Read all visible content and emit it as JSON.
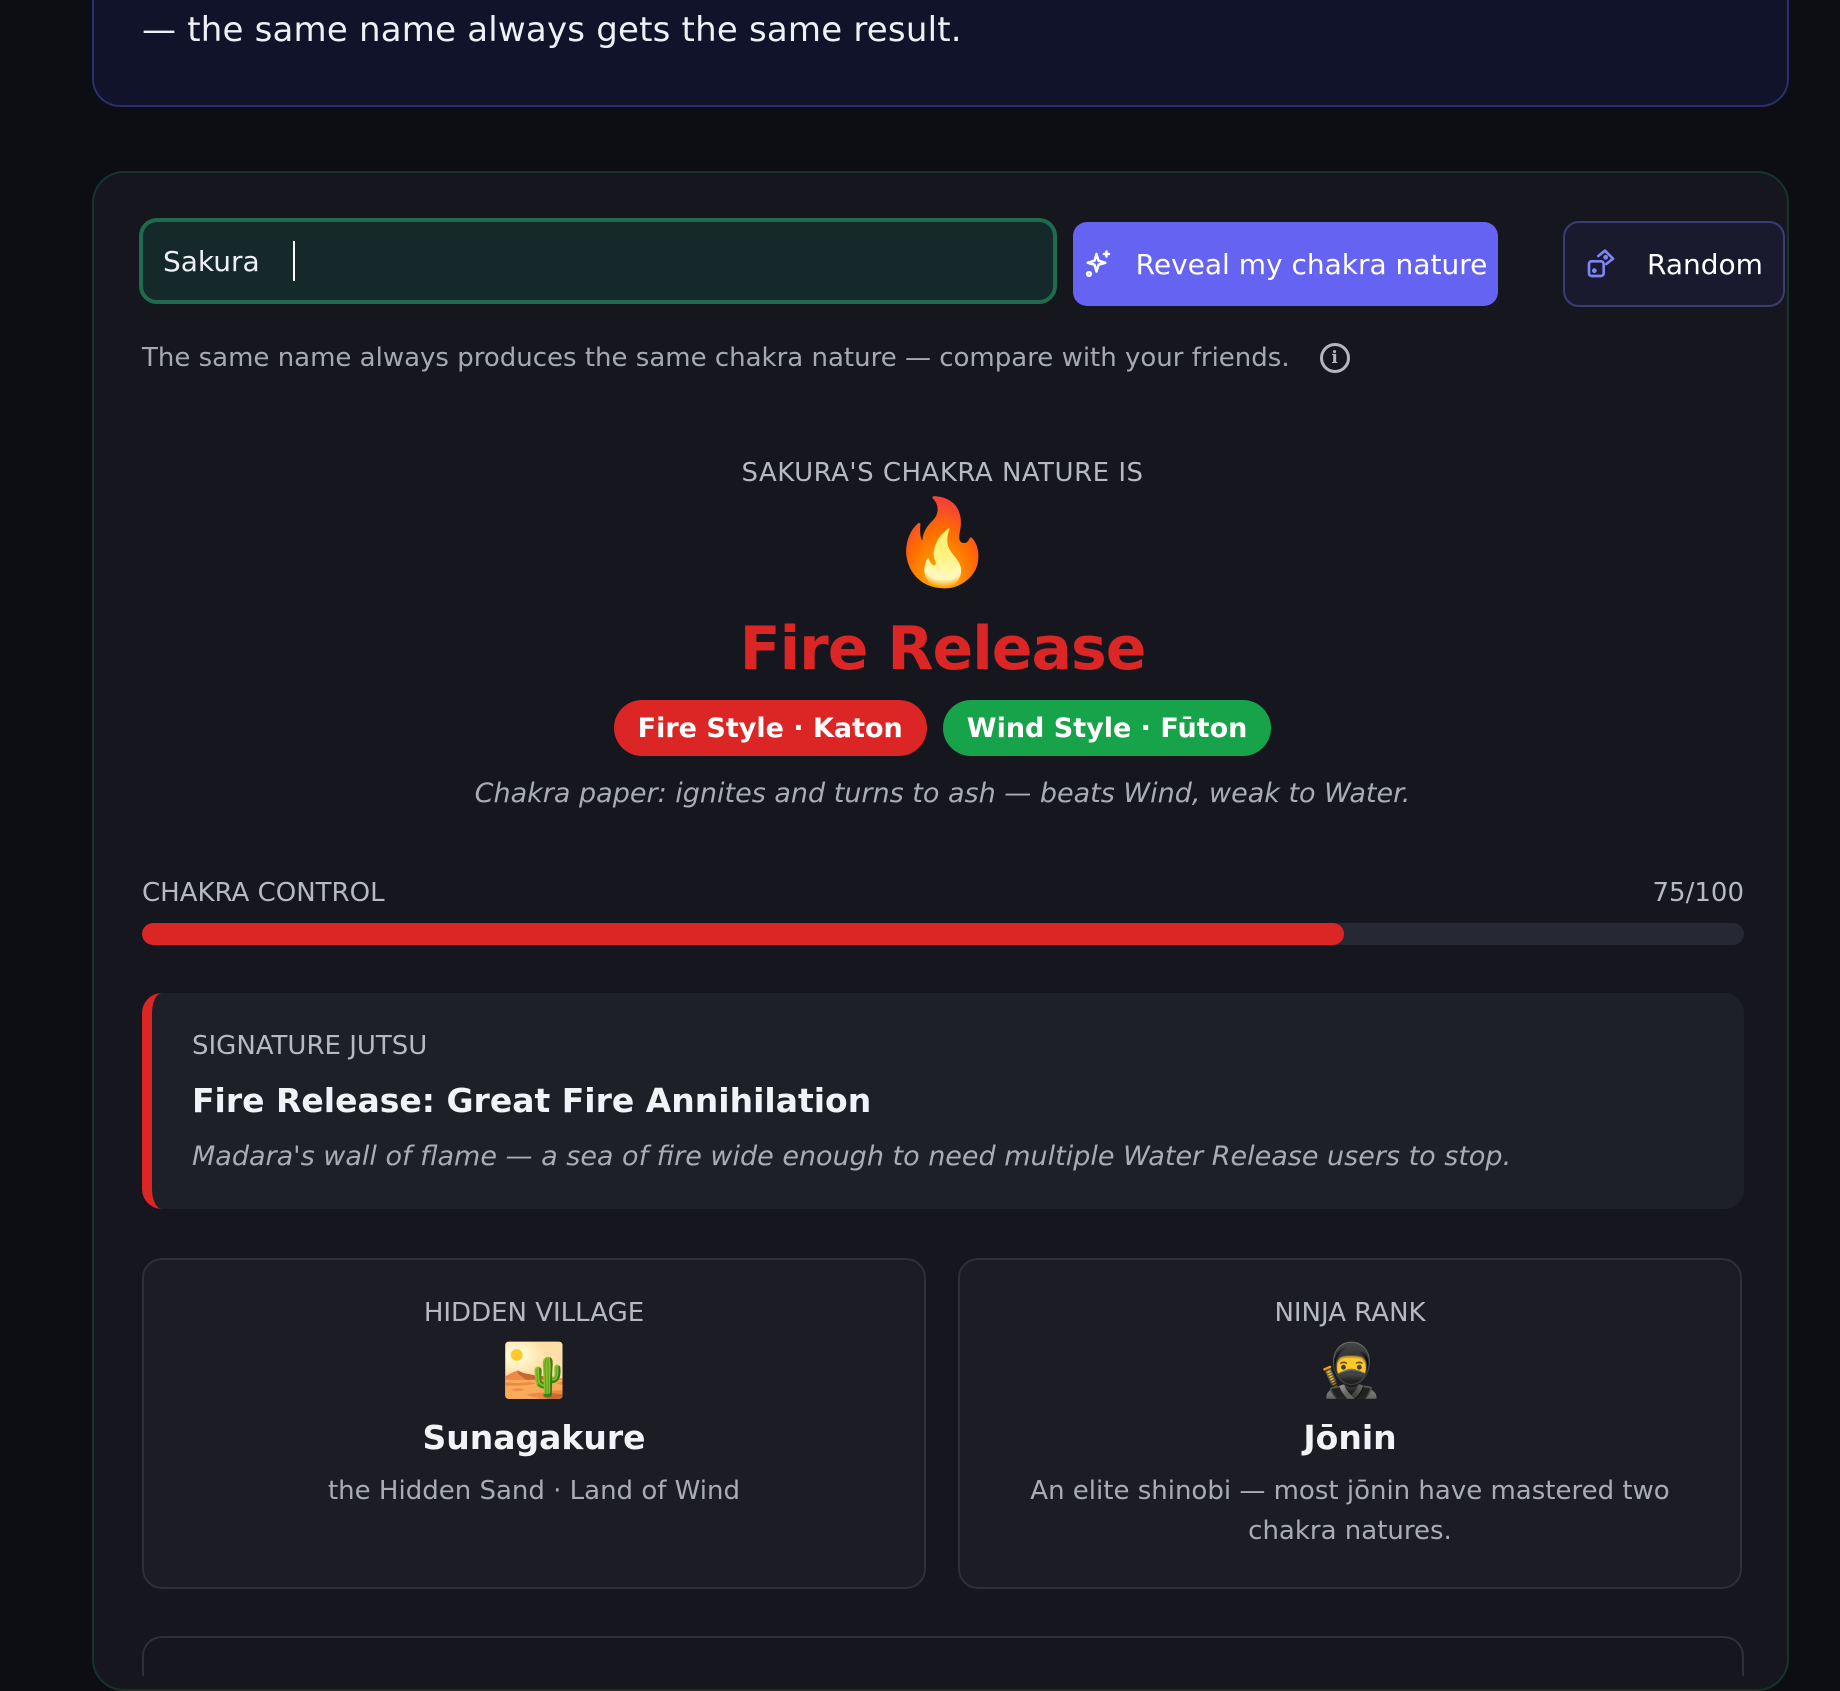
{
  "intro": {
    "tail_text": "— the same name always gets the same result."
  },
  "form": {
    "name_value": "Sakura",
    "reveal_label": "Reveal my chakra nature",
    "random_label": "Random",
    "hint": "The same name always produces the same chakra nature — compare with your friends."
  },
  "result": {
    "eyebrow": "SAKURA'S CHAKRA NATURE IS",
    "emoji": "🔥",
    "title": "Fire Release",
    "styles": [
      "Fire Style · Katon",
      "Wind Style · Fūton"
    ],
    "chakra_paper": "Chakra paper: ignites and turns to ash — beats Wind, weak to Water.",
    "colors": {
      "fire": "#dc2626",
      "wind": "#16a34a",
      "accent": "#6563f2"
    }
  },
  "control": {
    "label": "CHAKRA CONTROL",
    "score_text": "75/100",
    "value": 75
  },
  "jutsu": {
    "label": "SIGNATURE JUTSU",
    "name": "Fire Release: Great Fire Annihilation",
    "description": "Madara's wall of flame — a sea of fire wide enough to need multiple Water Release users to stop."
  },
  "village": {
    "label": "HIDDEN VILLAGE",
    "emoji": "🏜️",
    "name": "Sunagakure",
    "sub": "the Hidden Sand · Land of Wind"
  },
  "rank": {
    "label": "NINJA RANK",
    "emoji": "🥷",
    "name": "Jōnin",
    "sub": "An elite shinobi — most jōnin have mastered two chakra natures."
  },
  "icons": {
    "reveal": "sparkles-icon",
    "random": "dice-icon",
    "hint": "info-icon"
  }
}
